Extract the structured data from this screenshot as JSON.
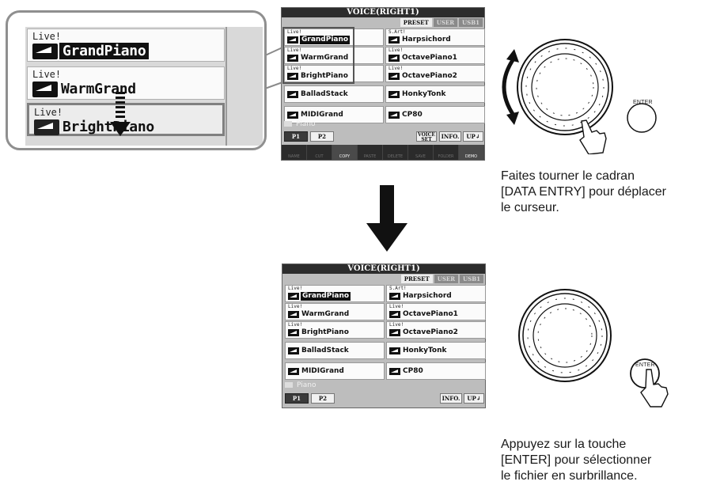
{
  "zoom": {
    "items": [
      {
        "live": "Live!",
        "name": "GrandPiano",
        "selected": false,
        "inverse": true
      },
      {
        "live": "Live!",
        "name": "WarmGrand",
        "selected": false,
        "inverse": false
      },
      {
        "live": "Live!",
        "name": "BrightPiano",
        "selected": true,
        "inverse": false
      }
    ]
  },
  "screen_top": {
    "title": "VOICE(RIGHT1)",
    "tabs": [
      "PRESET",
      "USER",
      "USB1"
    ],
    "left_voices": [
      {
        "prefix": "Live!",
        "name": "GrandPiano"
      },
      {
        "prefix": "Live!",
        "name": "WarmGrand"
      },
      {
        "prefix": "Live!",
        "name": "BrightPiano"
      },
      {
        "prefix": "",
        "name": "BalladStack"
      },
      {
        "prefix": "",
        "name": "MIDIGrand"
      }
    ],
    "right_voices": [
      {
        "prefix": "S.Art!",
        "name": "Harpsichord"
      },
      {
        "prefix": "Live!",
        "name": "OctavePiano1"
      },
      {
        "prefix": "Live!",
        "name": "OctavePiano2"
      },
      {
        "prefix": "",
        "name": "HonkyTonk"
      },
      {
        "prefix": "",
        "name": "CP80"
      }
    ],
    "folder": "Piano",
    "page1": "P1",
    "page2": "P2",
    "voice_set_line1": "VOICE",
    "voice_set_line2": "SET",
    "info": "INFO.",
    "up": "UP↲",
    "bottom_bar": [
      "NAME",
      "CUT",
      "COPY",
      "PASTE",
      "DELETE",
      "SAVE",
      "FOLDER",
      "DEMO"
    ]
  },
  "screen_bottom": {
    "title": "VOICE(RIGHT1)",
    "tabs": [
      "PRESET",
      "USER",
      "USB1"
    ],
    "left_voices": [
      {
        "prefix": "Live!",
        "name": "GrandPiano"
      },
      {
        "prefix": "Live!",
        "name": "WarmGrand"
      },
      {
        "prefix": "Live!",
        "name": "BrightPiano"
      },
      {
        "prefix": "",
        "name": "BalladStack"
      },
      {
        "prefix": "",
        "name": "MIDIGrand"
      }
    ],
    "right_voices": [
      {
        "prefix": "S.Art!",
        "name": "Harpsichord"
      },
      {
        "prefix": "Live!",
        "name": "OctavePiano1"
      },
      {
        "prefix": "Live!",
        "name": "OctavePiano2"
      },
      {
        "prefix": "",
        "name": "HonkyTonk"
      },
      {
        "prefix": "",
        "name": "CP80"
      }
    ],
    "folder": "Piano",
    "page1": "P1",
    "page2": "P2",
    "info": "INFO.",
    "up": "UP↲"
  },
  "dial_top": {
    "enter_label": "ENTER"
  },
  "dial_bottom": {
    "enter_label": "ENTER"
  },
  "captions": {
    "top": [
      "Faites tourner le cadran",
      "[DATA ENTRY] pour déplacer",
      "le curseur."
    ],
    "bottom": [
      "Appuyez sur la touche",
      "[ENTER] pour sélectionner",
      "le fichier en surbrillance."
    ]
  },
  "icons": [
    "piano-icon",
    "keyboard-icon",
    "folder-icon",
    "hand-pointer-icon",
    "rotate-arrow-icon",
    "arrow-down-icon"
  ],
  "colors": {
    "lcd_background": "#bdbdbd",
    "lcd_title_bar": "#2c2c2c",
    "callout_border": "#8f8f8f",
    "arrow": "#111111"
  }
}
